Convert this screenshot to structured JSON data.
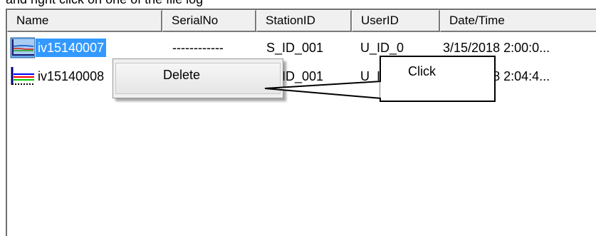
{
  "top_caption": "and right click on one of the file log",
  "list": {
    "columns": [
      "Name",
      "SerialNo",
      "StationID",
      "UserID",
      "Date/Time"
    ],
    "rows": [
      {
        "name": "iv15140007",
        "serial": "------------",
        "station": "S_ID_001",
        "user": "U_ID_0",
        "datetime": "3/15/2018 2:00:0...",
        "selected": true,
        "icon": "iv-log-file-icon"
      },
      {
        "name": "iv15140008",
        "serial": "------------",
        "station": "S_ID_001",
        "user": "U_ID_0",
        "datetime": "3/15/2018 2:04:4...",
        "selected": false,
        "icon": "iv-log-file-icon"
      }
    ]
  },
  "context_menu": {
    "items": [
      "Delete"
    ]
  },
  "callout": {
    "text": "Click"
  },
  "colors": {
    "selection": "#3399ff",
    "header_bg": "#f0f0f0",
    "menu_bg": "#f0f0f0"
  }
}
